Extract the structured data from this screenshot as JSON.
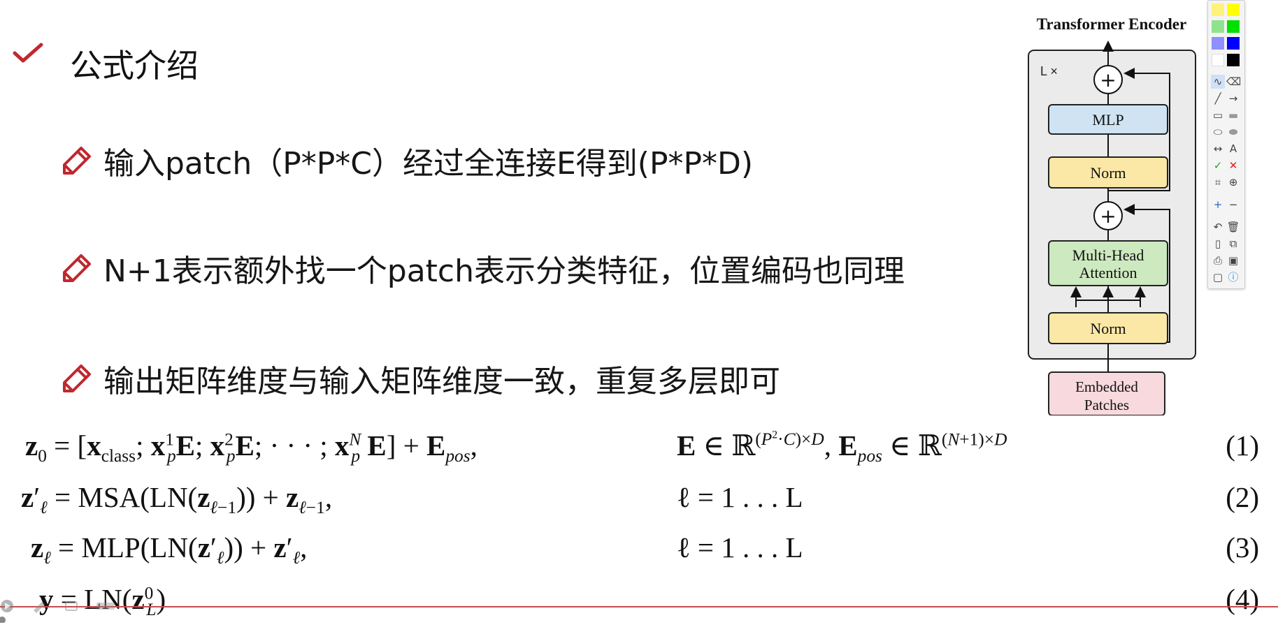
{
  "slide": {
    "title": "公式介绍",
    "bullets": [
      {
        "text": "输入patch（P*P*C）经过全连接E得到(P*P*D)"
      },
      {
        "text": "N+1表示额外找一个patch表示分类特征，位置编码也同理"
      },
      {
        "text": "输出矩阵维度与输入矩阵维度一致，重复多层即可"
      }
    ]
  },
  "diagram": {
    "title": "Transformer Encoder",
    "repeat_label": "L ×",
    "blocks": {
      "mlp": "MLP",
      "norm_top": "Norm",
      "attention_line1": "Multi-Head",
      "attention_line2": "Attention",
      "norm_bottom": "Norm",
      "input_line1": "Embedded",
      "input_line2": "Patches"
    },
    "add_symbol": "+",
    "colors": {
      "mlp": "#cfe3f3",
      "norm": "#fbe8a6",
      "attention": "#cde9bf",
      "input": "#f7d9de",
      "frame": "#ebebeb"
    }
  },
  "equations": [
    {
      "number": "(1)",
      "condition": "E ∈ ℝ^((P²·C)×D), E_pos ∈ ℝ^((N+1)×D)"
    },
    {
      "number": "(2)",
      "condition": "ℓ = 1 . . . L"
    },
    {
      "number": "(3)",
      "condition": "ℓ = 1 . . . L"
    },
    {
      "number": "(4)",
      "condition": ""
    }
  ],
  "toolbar": {
    "colors": [
      "#fff27a",
      "#ffff00",
      "#8fe38f",
      "#00e000",
      "#8f8fff",
      "#0000ff",
      "#ffffff",
      "#000000"
    ],
    "tools": [
      "freehand-icon",
      "eraser-icon",
      "line-icon",
      "arrow-icon",
      "rectangle-icon",
      "filled-rectangle-icon",
      "ellipse-icon",
      "filled-ellipse-icon",
      "double-arrow-icon",
      "text-icon",
      "check-mark-icon",
      "cross-mark-icon",
      "crop-icon",
      "zoom-icon",
      "plus-icon",
      "minus-icon",
      "undo-icon",
      "trash-icon",
      "new-page-icon",
      "copy-icon",
      "print-icon",
      "save-icon",
      "screen-icon",
      "info-icon"
    ]
  },
  "accent_color": "#c0282e"
}
